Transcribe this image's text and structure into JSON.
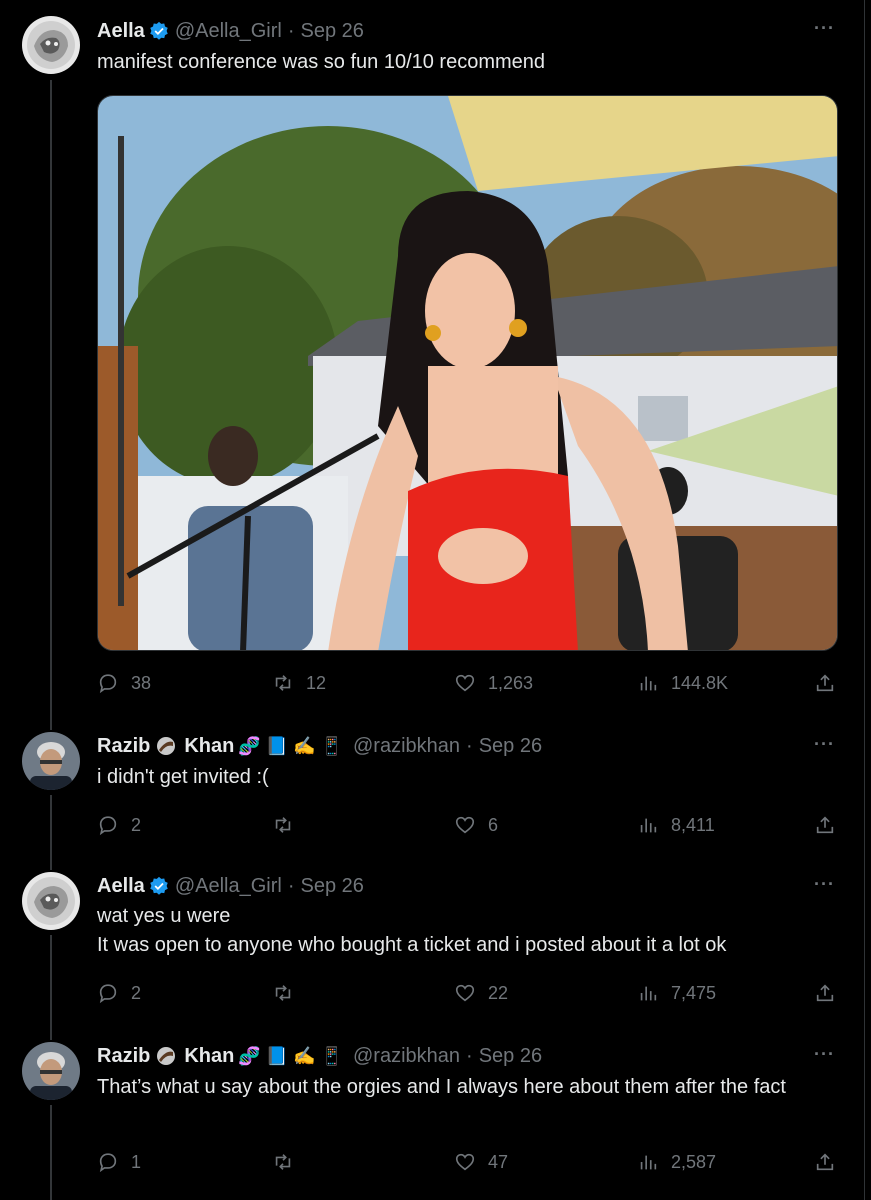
{
  "tweets": [
    {
      "name": "Aella",
      "verified": true,
      "handle": "@Aella_Girl",
      "date": "Sep 26",
      "text": "manifest conference was so fun 10/10 recommend",
      "replies": "38",
      "retweets": "12",
      "likes": "1,263",
      "views": "144.8K"
    },
    {
      "name_first": "Razib",
      "name_last": "Khan",
      "name_emojis": "🧬 📘 ✍️ 📱",
      "handle": "@razibkhan",
      "date": "Sep 26",
      "text": "i didn't get invited :(",
      "replies": "2",
      "retweets": "",
      "likes": "6",
      "views": "8,411"
    },
    {
      "name": "Aella",
      "verified": true,
      "handle": "@Aella_Girl",
      "date": "Sep 26",
      "text_line1": "wat yes u were",
      "text_line2": "It was open to anyone who bought a ticket and i posted about it a lot ok",
      "replies": "2",
      "retweets": "",
      "likes": "22",
      "views": "7,475"
    },
    {
      "name_first": "Razib",
      "name_last": "Khan",
      "name_emojis": "🧬 📘 ✍️ 📱",
      "handle": "@razibkhan",
      "date": "Sep 26",
      "text": "That’s what u say about the orgies and I always here about them after the fact",
      "replies": "1",
      "retweets": "",
      "likes": "47",
      "views": "2,587"
    }
  ],
  "icons": {
    "reply": "reply-icon",
    "retweet": "retweet-icon",
    "like": "heart-icon",
    "views": "views-icon",
    "share": "share-icon",
    "more": "more-icon",
    "verified": "verified-badge-icon"
  },
  "colors": {
    "background": "#000000",
    "text": "#e7e9ea",
    "muted": "#71767b",
    "verified": "#1d9bf0"
  }
}
